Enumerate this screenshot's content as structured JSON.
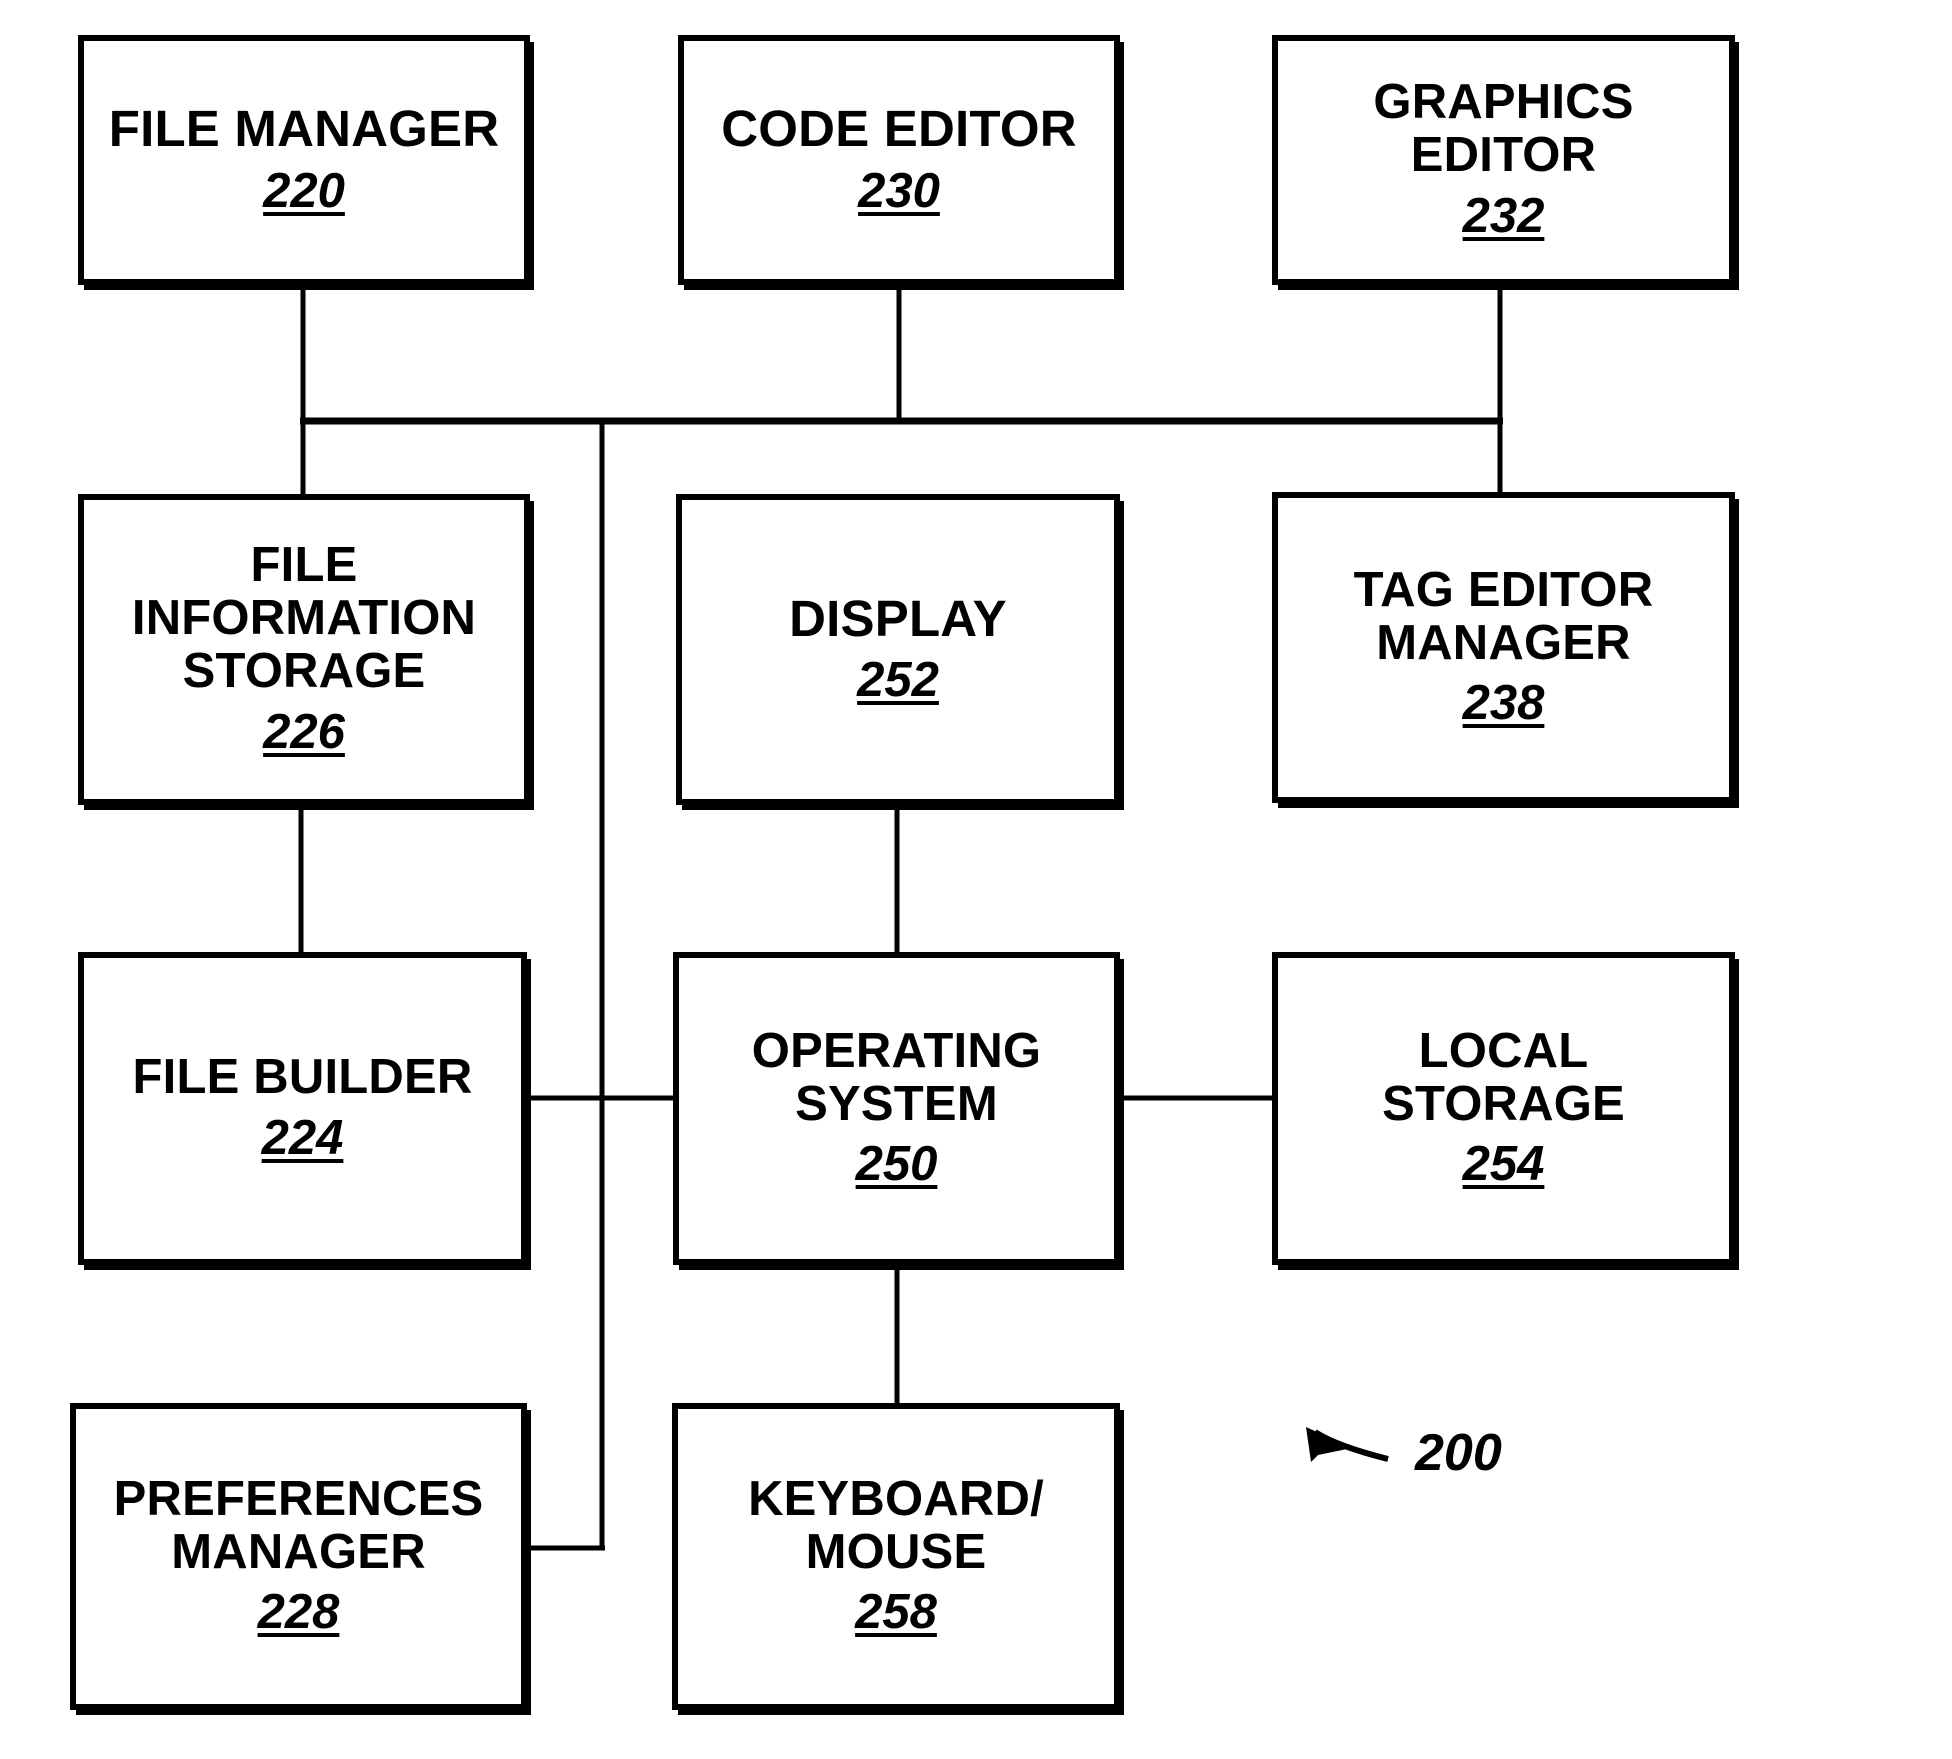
{
  "figure": {
    "reference_label": "200",
    "blocks": [
      {
        "id": "file_manager",
        "title": "FILE MANAGER",
        "refnum": "220"
      },
      {
        "id": "code_editor",
        "title": "CODE EDITOR",
        "refnum": "230"
      },
      {
        "id": "graphics_editor",
        "title": "GRAPHICS\nEDITOR",
        "refnum": "232"
      },
      {
        "id": "file_info_storage",
        "title": "FILE\nINFORMATION\nSTORAGE",
        "refnum": "226"
      },
      {
        "id": "display",
        "title": "DISPLAY",
        "refnum": "252"
      },
      {
        "id": "tag_editor_manager",
        "title": "TAG EDITOR\nMANAGER",
        "refnum": "238"
      },
      {
        "id": "file_builder",
        "title": "FILE BUILDER",
        "refnum": "224"
      },
      {
        "id": "operating_system",
        "title": "OPERATING\nSYSTEM",
        "refnum": "250"
      },
      {
        "id": "local_storage",
        "title": "LOCAL\nSTORAGE",
        "refnum": "254"
      },
      {
        "id": "preferences_manager",
        "title": "PREFERENCES\nMANAGER",
        "refnum": "228"
      },
      {
        "id": "keyboard_mouse",
        "title": "KEYBOARD/\nMOUSE",
        "refnum": "258"
      }
    ],
    "colors": {
      "ink": "#000000",
      "paper": "#ffffff"
    }
  }
}
